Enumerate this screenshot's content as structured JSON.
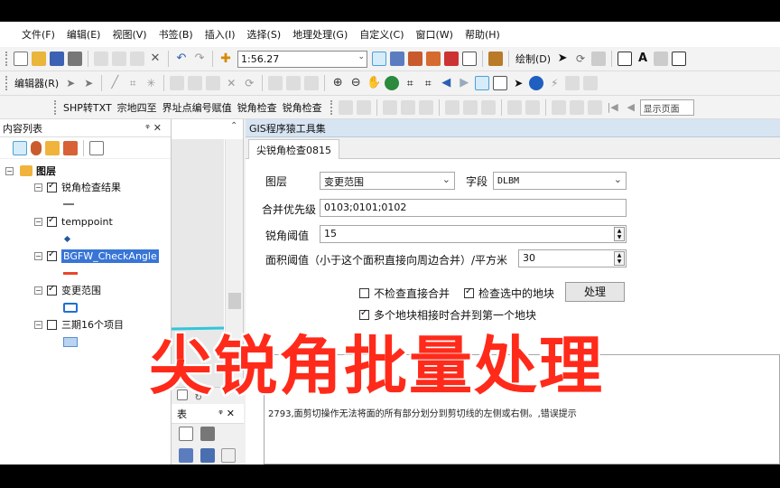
{
  "menu": [
    "文件(F)",
    "编辑(E)",
    "视图(V)",
    "书签(B)",
    "插入(I)",
    "选择(S)",
    "地理处理(G)",
    "自定义(C)",
    "窗口(W)",
    "帮助(H)"
  ],
  "toolbar1": {
    "scale": "1:56.27",
    "draw_label": "绘制(D)"
  },
  "toolbar2": {
    "editor_label": "编辑器(R)"
  },
  "toolbar3": {
    "items": [
      "SHP转TXT",
      "宗地四至",
      "界址点编号赋值",
      "锐角检查",
      "锐角检查"
    ],
    "search_placeholder": "显示页面"
  },
  "toc": {
    "title": "内容列表",
    "group": "图层",
    "layers": [
      {
        "name": "锐角检查结果",
        "checked": true,
        "selected": false
      },
      {
        "name": "temppoint",
        "checked": true,
        "selected": false
      },
      {
        "name": "BGFW_CheckAngle",
        "checked": true,
        "selected": true
      },
      {
        "name": "变更范围",
        "checked": true,
        "selected": false
      },
      {
        "name": "三期16个项目",
        "checked": false,
        "selected": false
      }
    ]
  },
  "table_panel": {
    "title": "表"
  },
  "gis": {
    "title": "GIS程序猿工具集",
    "tab": "尖锐角检查0815",
    "layer_label": "图层",
    "layer_value": "变更范围",
    "field_label": "字段",
    "field_value": "DLBM",
    "priority_label": "合并优先级",
    "priority_value": "0103;0101;0102",
    "angle_label": "锐角阈值",
    "angle_value": "15",
    "area_label": "面积阈值（小于这个面积直接向周边合并）/平方米",
    "area_value": "30",
    "chk_no_merge": "不检查直接合并",
    "chk_selected": "检查选中的地块",
    "process_btn": "处理",
    "chk_multi": "多个地块相接时合并到第一个地块",
    "log_lines": [
      "2793,面剪切操作无法将面的所有部分划分到剪切线的左侧或右侧。,错误提示"
    ]
  },
  "caption": "尖锐角批量处理",
  "colors": {
    "caption": "#ff2a1a",
    "selection": "#3875d7",
    "panel_title": "#d7e4f2",
    "cyan_feature": "#30c6d9",
    "red_feature": "#e8462c",
    "blue_feature": "#1f6fd1"
  }
}
